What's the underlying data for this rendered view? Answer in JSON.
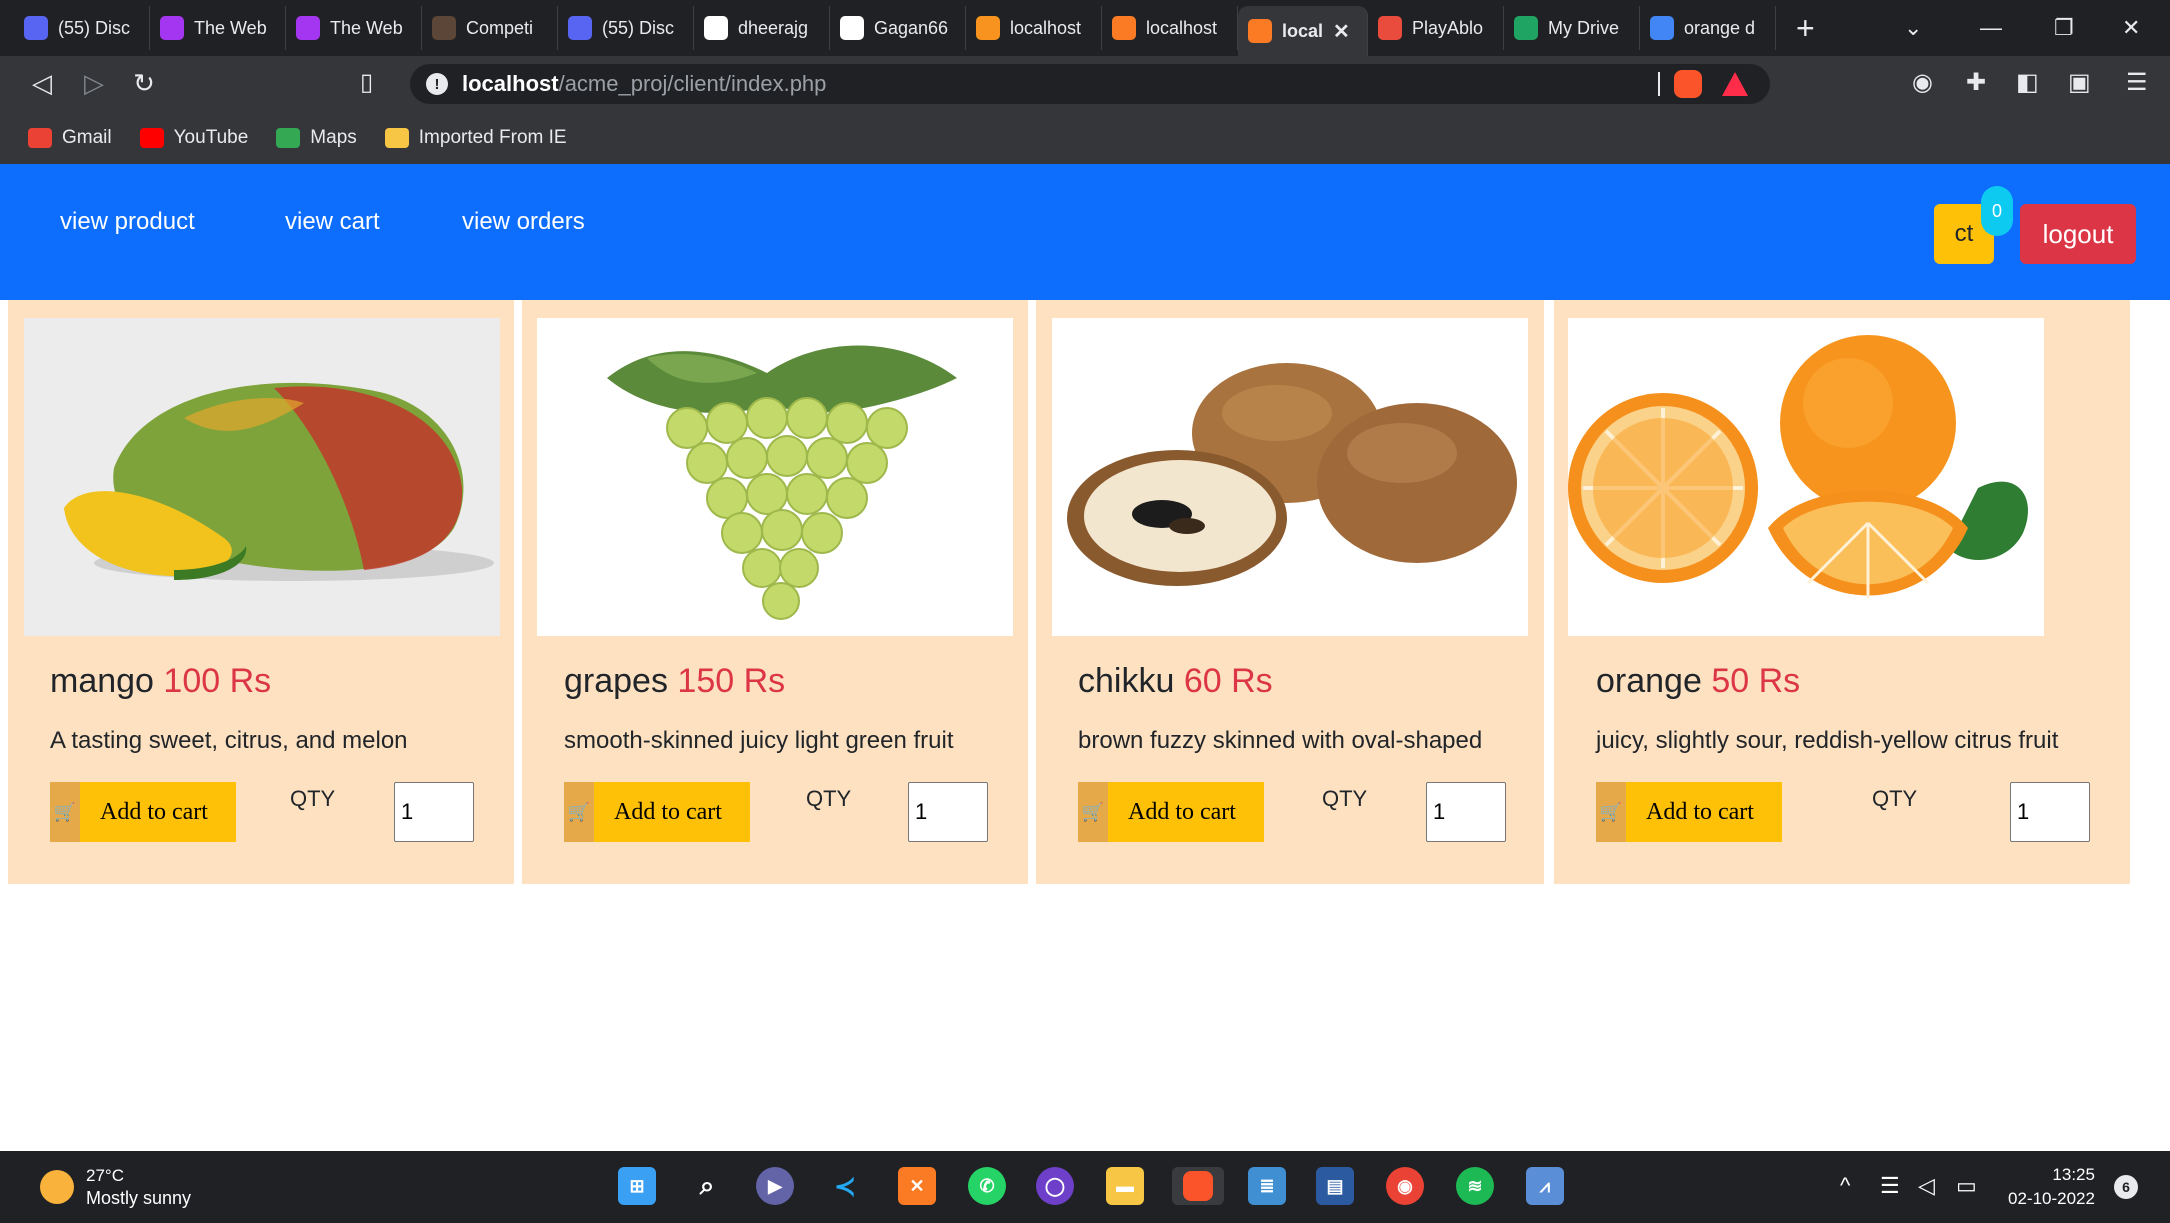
{
  "browser": {
    "tabs": [
      {
        "title": "(55) Disc",
        "icon": "discord-icon",
        "color": "#5865f2"
      },
      {
        "title": "The Web",
        "icon": "udemy-icon",
        "color": "#a435f0"
      },
      {
        "title": "The Web",
        "icon": "udemy-icon",
        "color": "#a435f0"
      },
      {
        "title": "Competi",
        "icon": "codechef-icon",
        "color": "#5b4638"
      },
      {
        "title": "(55) Disc",
        "icon": "discord-icon",
        "color": "#5865f2"
      },
      {
        "title": "dheerajg",
        "icon": "github-icon",
        "color": "#ffffff"
      },
      {
        "title": "Gagan66",
        "icon": "github-icon",
        "color": "#ffffff"
      },
      {
        "title": "localhost",
        "icon": "localhost-icon",
        "color": "#f7931e"
      },
      {
        "title": "localhost",
        "icon": "xampp-icon",
        "color": "#fb7a24"
      },
      {
        "title": "local",
        "icon": "xampp-icon",
        "color": "#fb7a24",
        "active": true
      },
      {
        "title": "PlayAblo",
        "icon": "playablo-icon",
        "color": "#e94c3c"
      },
      {
        "title": "My Drive",
        "icon": "google-drive-icon",
        "color": "#1fa463"
      },
      {
        "title": "orange d",
        "icon": "google-icon",
        "color": "#4285f4"
      }
    ],
    "url_host": "localhost",
    "url_path": "/acme_proj/client/index.php",
    "bookmarks": [
      {
        "label": "Gmail",
        "icon": "gmail-icon",
        "color": "#ea4335"
      },
      {
        "label": "YouTube",
        "icon": "youtube-icon",
        "color": "#ff0000"
      },
      {
        "label": "Maps",
        "icon": "maps-icon",
        "color": "#34a853"
      },
      {
        "label": "Imported From IE",
        "icon": "folder-icon",
        "color": "#f6c644"
      }
    ]
  },
  "nav": {
    "links": [
      "view product",
      "view cart",
      "view orders"
    ],
    "cart_label": "ct",
    "cart_count": "0",
    "logout_label": "logout",
    "brand_color": "#0d6efd"
  },
  "products": [
    {
      "name": "mango",
      "price": "100 Rs",
      "desc": "A tasting sweet, citrus, and melon",
      "button": "Add to cart",
      "qty_label": "QTY",
      "qty": "1"
    },
    {
      "name": "grapes",
      "price": "150 Rs",
      "desc": "smooth-skinned juicy light green fruit",
      "button": "Add to cart",
      "qty_label": "QTY",
      "qty": "1"
    },
    {
      "name": "chikku",
      "price": "60 Rs",
      "desc": "brown fuzzy skinned with oval-shaped",
      "button": "Add to cart",
      "qty_label": "QTY",
      "qty": "1"
    },
    {
      "name": "orange",
      "price": "50 Rs",
      "desc": "juicy, slightly sour, reddish-yellow citrus fruit",
      "button": "Add to cart",
      "qty_label": "QTY",
      "qty": "1"
    }
  ],
  "taskbar": {
    "temp": "27°C",
    "weather": "Mostly sunny",
    "time": "13:25",
    "date": "02-10-2022",
    "notifications": "6"
  }
}
